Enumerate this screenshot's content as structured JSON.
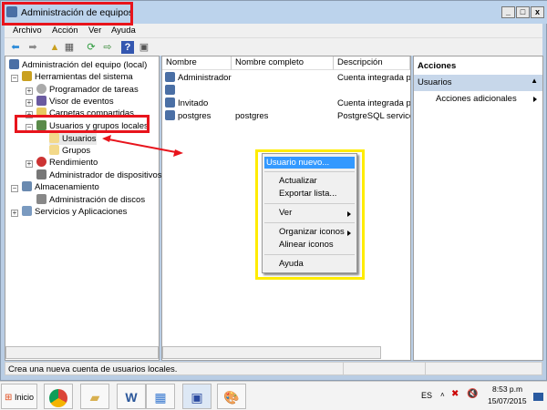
{
  "window": {
    "title": "Administración de equipos",
    "min": "_",
    "max": "□",
    "close": "x"
  },
  "menu": [
    "Archivo",
    "Acción",
    "Ver",
    "Ayuda"
  ],
  "tree": [
    {
      "label": "Administración del equipo (local)"
    },
    {
      "label": "Herramientas del sistema",
      "exp": "−"
    },
    {
      "label": "Programador de tareas",
      "exp": "+"
    },
    {
      "label": "Visor de eventos",
      "exp": "+"
    },
    {
      "label": "Carpetas compartidas",
      "exp": "+"
    },
    {
      "label": "Usuarios y grupos locales",
      "exp": "−"
    },
    {
      "label": "Usuarios"
    },
    {
      "label": "Grupos"
    },
    {
      "label": "Rendimiento",
      "exp": "+"
    },
    {
      "label": "Administrador de dispositivos"
    },
    {
      "label": "Almacenamiento",
      "exp": "−"
    },
    {
      "label": "Administración de discos"
    },
    {
      "label": "Servicios y Aplicaciones",
      "exp": "+"
    }
  ],
  "list": {
    "headers": [
      "Nombre",
      "Nombre completo",
      "Descripción"
    ],
    "rows": [
      [
        "Administrador",
        "",
        "Cuenta integrada pa"
      ],
      [
        "",
        "",
        ""
      ],
      [
        "Invitado",
        "",
        "Cuenta integrada pa"
      ],
      [
        "postgres",
        "postgres",
        "PostgreSQL service a"
      ]
    ]
  },
  "actions": {
    "title": "Acciones",
    "section": "Usuarios",
    "item": "Acciones adicionales"
  },
  "context_menu": [
    "Usuario nuevo...",
    "Actualizar",
    "Exportar lista...",
    "Ver",
    "Organizar iconos",
    "Alinear iconos",
    "Ayuda"
  ],
  "status": "Crea una nueva cuenta de usuarios locales.",
  "taskbar": {
    "start": "Inicio",
    "lang": "ES",
    "time": "8:53 p.m",
    "date": "15/07/2015"
  }
}
